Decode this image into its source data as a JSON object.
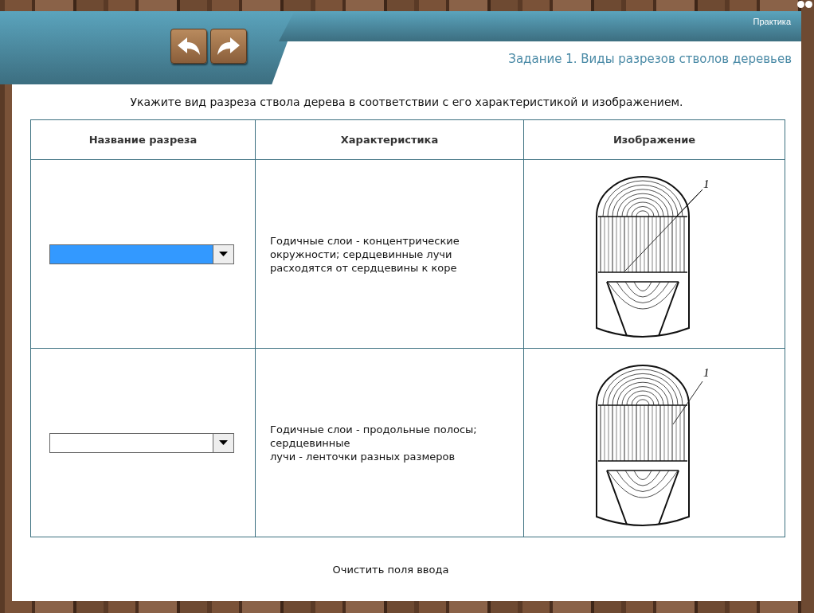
{
  "section_tab": "Практика",
  "title": "Задание 1. Виды разрезов стволов деревьев",
  "instruction": "Укажите вид разреза ствола дерева в соответствии с его характеристикой и изображением.",
  "table": {
    "columns": [
      "Название разреза",
      "Характеристика",
      "Изображение"
    ],
    "rows": [
      {
        "select": {
          "focused": true
        },
        "characteristic": [
          "Годичные слои - концентрические",
          "окружности; сердцевинные лучи",
          "расходятся от сердцевины к коре"
        ],
        "figure": {
          "kind": "double-leader",
          "label": "1"
        }
      },
      {
        "select": {
          "focused": false
        },
        "characteristic": [
          "Годичные слои - продольные полосы;",
          "сердцевинные",
          "лучи - ленточки разных размеров"
        ],
        "figure": {
          "kind": "single-leader",
          "label": "1"
        }
      }
    ]
  },
  "clear_button": "Очистить поля ввода"
}
